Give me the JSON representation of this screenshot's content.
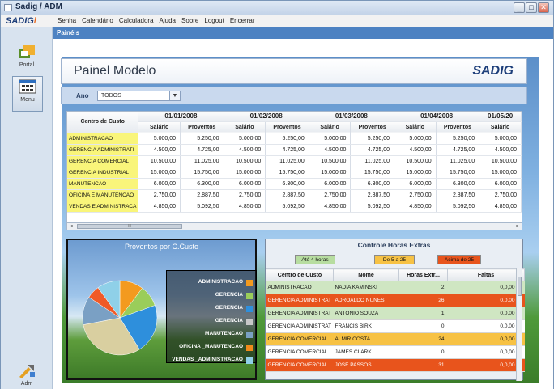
{
  "window": {
    "title": "Sadig / ADM",
    "min": "_",
    "max": "□",
    "close": "✕"
  },
  "brand": {
    "name": "SADIG",
    "mark": "/"
  },
  "menu": [
    "Senha",
    "Calendário",
    "Calculadora",
    "Ajuda",
    "Sobre",
    "Logout",
    "Encerrar"
  ],
  "sidebar": {
    "portal": "Portal",
    "menu": "Menu",
    "adm": "Adm"
  },
  "tab": "Painéis",
  "header": {
    "title": "Painel Modelo",
    "logo": "SADIG"
  },
  "filter": {
    "label": "Ano",
    "value": "TODOS"
  },
  "grid": {
    "col_header": "Centro de Custo",
    "sub_salario": "Salário",
    "sub_proventos": "Proventos",
    "dates": [
      "01/01/2008",
      "01/02/2008",
      "01/03/2008",
      "01/04/2008",
      "01/05/20"
    ],
    "rows": [
      {
        "cc": "ADMINISTRACAO",
        "v": [
          "5.000,00",
          "5.250,00",
          "5.000,00",
          "5.250,00",
          "5.000,00",
          "5.250,00",
          "5.000,00",
          "5.250,00",
          "5.000,00"
        ]
      },
      {
        "cc": "GERENCIA ADMINISTRATI",
        "v": [
          "4.500,00",
          "4.725,00",
          "4.500,00",
          "4.725,00",
          "4.500,00",
          "4.725,00",
          "4.500,00",
          "4.725,00",
          "4.500,00"
        ]
      },
      {
        "cc": "GERENCIA COMERCIAL",
        "v": [
          "10.500,00",
          "11.025,00",
          "10.500,00",
          "11.025,00",
          "10.500,00",
          "11.025,00",
          "10.500,00",
          "11.025,00",
          "10.500,00"
        ]
      },
      {
        "cc": "GERENCIA INDUSTRIAL",
        "v": [
          "15.000,00",
          "15.750,00",
          "15.000,00",
          "15.750,00",
          "15.000,00",
          "15.750,00",
          "15.000,00",
          "15.750,00",
          "15.000,00"
        ]
      },
      {
        "cc": "MANUTENCAO",
        "v": [
          "6.000,00",
          "6.300,00",
          "6.000,00",
          "6.300,00",
          "6.000,00",
          "6.300,00",
          "6.000,00",
          "6.300,00",
          "6.000,00"
        ]
      },
      {
        "cc": "OFICINA E MANUTENCAO",
        "v": [
          "2.750,00",
          "2.887,50",
          "2.750,00",
          "2.887,50",
          "2.750,00",
          "2.887,50",
          "2.750,00",
          "2.887,50",
          "2.750,00"
        ]
      },
      {
        "cc": "VENDAS E ADMINISTRACA",
        "v": [
          "4.850,00",
          "5.092,50",
          "4.850,00",
          "5.092,50",
          "4.850,00",
          "5.092,50",
          "4.850,00",
          "5.092,50",
          "4.850,00"
        ]
      }
    ],
    "scroll_mark": "III"
  },
  "pie": {
    "title": "Proventos por C.Custo",
    "legend": [
      {
        "label": "ADMINISTRACAO",
        "color": "#f39a1f"
      },
      {
        "label": "GERENCIA",
        "color": "#9acd5a"
      },
      {
        "label": "GERENCIA",
        "color": "#2e8fdc"
      },
      {
        "label": "GERENCIA",
        "color": "#c8c8c8"
      },
      {
        "label": "MANUTENCAO",
        "color": "#7aa0c4"
      },
      {
        "label": "OFICINA _MANUTENCAO",
        "color": "#f08a1a"
      },
      {
        "label": "VENDAS _ADMINISTRACAO",
        "color": "#8fd0e8"
      }
    ]
  },
  "chart_data": {
    "type": "pie",
    "title": "Proventos por C.Custo",
    "labels": [
      "ADMINISTRACAO",
      "GERENCIA ADMINISTRATI",
      "GERENCIA COMERCIAL",
      "GERENCIA INDUSTRIAL",
      "MANUTENCAO",
      "OFICINA E MANUTENCAO",
      "VENDAS E ADMINISTRACA"
    ],
    "values": [
      5250,
      4725,
      11025,
      15750,
      6300,
      2887.5,
      5092.5
    ],
    "colors": [
      "#f39a1f",
      "#9acd5a",
      "#2e8fdc",
      "#d9cfa0",
      "#7aa0c4",
      "#f05a28",
      "#8fd0e8"
    ]
  },
  "overtime": {
    "title": "Controle Horas Extras",
    "chips": [
      {
        "label": "Até 4 horas",
        "color": "#b7dda0"
      },
      {
        "label": "De 5 a 25",
        "color": "#f7c244"
      },
      {
        "label": "Acima de 25",
        "color": "#e8541c"
      }
    ],
    "headers": [
      "Centro de Custo",
      "Nome",
      "Horas Extr...",
      "Faltas"
    ],
    "rows": [
      {
        "cc": "ADMINISTRACAO",
        "nome": "NADIA KAMINSKI",
        "horas": "2",
        "faltas": "0,0,00",
        "color": "#cfe6c2"
      },
      {
        "cc": "GERENCIA ADMINISTRAT",
        "nome": "ADROALDO NUNES",
        "horas": "26",
        "faltas": "0,0,00",
        "color": "#e8541c"
      },
      {
        "cc": "GERENCIA ADMINISTRAT",
        "nome": "ANTONIO SOUZA",
        "horas": "1",
        "faltas": "0,0,00",
        "color": "#cfe6c2"
      },
      {
        "cc": "GERENCIA ADMINISTRAT",
        "nome": "FRANCIS BIRK",
        "horas": "0",
        "faltas": "0,0,00",
        "color": "#ffffff"
      },
      {
        "cc": "GERENCIA COMERCIAL",
        "nome": "ALMIR COSTA",
        "horas": "24",
        "faltas": "0,0,00",
        "color": "#f7c244"
      },
      {
        "cc": "GERENCIA COMERCIAL",
        "nome": "JAMES CLARK",
        "horas": "0",
        "faltas": "0,0,00",
        "color": "#ffffff"
      },
      {
        "cc": "GERENCIA COMERCIAL",
        "nome": "JOSE PASSOS",
        "horas": "31",
        "faltas": "0,0,00",
        "color": "#e8541c"
      }
    ]
  }
}
